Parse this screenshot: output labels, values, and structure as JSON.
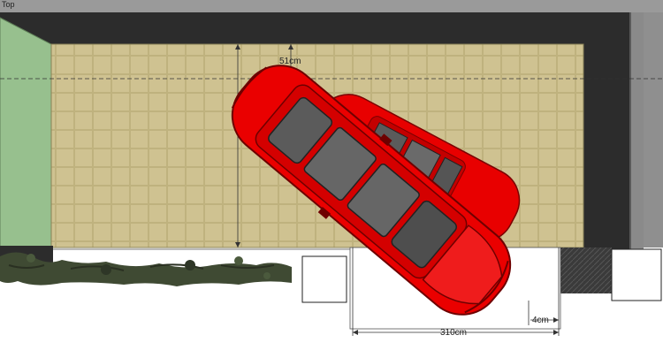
{
  "viewport": {
    "label": "Top"
  },
  "dimensions": {
    "top_gap": "51cm",
    "car_length": "310cm",
    "side_gap": "4cm"
  },
  "colors": {
    "floor": "#cfc291",
    "wall_dark": "#2b2b2b",
    "wall_outer": "#8a8a8a",
    "car_red": "#e80000",
    "hedge_green": "#97c08e",
    "window_glass": "#5b5b5b"
  },
  "icons": {
    "car_primary": "red-car-topview-icon",
    "car_secondary": "red-car-ghost-topview-icon",
    "plants": "hedge-plants-icon"
  }
}
